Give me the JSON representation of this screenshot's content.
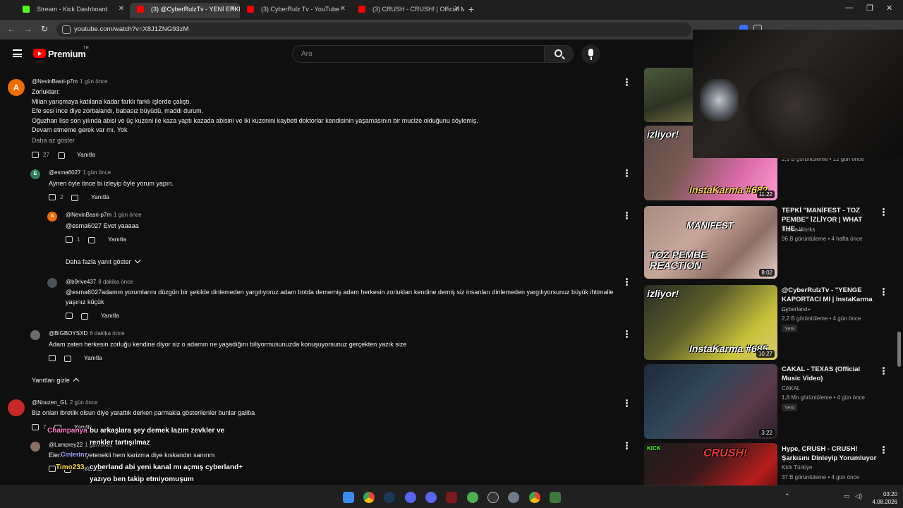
{
  "browser": {
    "tabs": [
      {
        "title": "Stream - Kick Dashboard",
        "active": false,
        "color": "#53fc18"
      },
      {
        "title": "(3) @CyberRulzTv - YENİ ERKEK",
        "active": true,
        "color": "#ff0000"
      },
      {
        "title": "(3) CyberRulz Tv - YouTube",
        "active": false,
        "color": "#ff0000"
      },
      {
        "title": "(3) CRUSH - CRUSH! | Official M",
        "active": false,
        "color": "#ff0000"
      }
    ],
    "url": "youtube.com/watch?v=X8J1ZNG93zM"
  },
  "youtube": {
    "logo_text": "Premium",
    "logo_region": "TR",
    "search_placeholder": "Ara"
  },
  "comments": [
    {
      "handle": "@NevinBasri-p7m",
      "time": "1 gün önce",
      "avatar_letter": "A",
      "avatar_color": "#ef6c00",
      "lines": [
        "Zorlukları:",
        "Milan yarışmaya katılana kadar farklı farklı işlerde çalıştı.",
        "Efe sesi ince diye zorbalandı, babasız büyüdü, maddi durum.",
        "Oğuzhan lise son yılında abisi ve üç kuzeni ile kaza yaptı kazada abisini ve iki kuzenini kaybeti doktorlar kendisinin yaşamasının bir mucize olduğunu söylemiş.",
        "Devam etmeme gerek var mı. Yok"
      ],
      "show_less": "Daha az göster",
      "likes": "27",
      "reply": "Yanıtla"
    },
    {
      "handle": "@esma6027",
      "time": "1 gün önce",
      "avatar_letter": "E",
      "avatar_color": "#2e7d57",
      "text": "Aynen öyle önce bi izleyip öyle yorum yapın.",
      "likes": "2",
      "reply": "Yanıtla"
    },
    {
      "handle": "@NevinBasri-p7m",
      "time": "1 gün önce",
      "avatar_letter": "A",
      "avatar_color": "#ef6c00",
      "text": "@esma6027 Evet yaaaaa",
      "likes": "1",
      "reply": "Yanıtla"
    },
    {
      "handle": "@b9rive437",
      "time": "8 dakika önce",
      "avatar_color": "#4a4f5a",
      "text": "@esma6027adamın yorumlarını düzgün bir şekilde dinlemeden yargılıyoruz adam botda dememiş adam herkesin zorlukları kendine demiş siz insanları dinlemeden yargılıyorsunuz büyük ihtimalle yaşınız küçük",
      "likes": "",
      "reply": "Yanıtla"
    },
    {
      "handle": "@BIGBOYSXD",
      "time": "6 dakika önce",
      "avatar_color": "#6b6b6b",
      "text": "Adam zaten herkesin zorluğu kendine diyor siz o adamın ne yaşadığını biliyormusunuzda konuşuyorsunuz gerçekten yazık size",
      "likes": "",
      "reply": "Yanıtla"
    },
    {
      "handle": "@Nouzen_GL",
      "time": "2 gün önce",
      "avatar_color": "#c62828",
      "text": "Biz onları ibretlik olsun diye yarattık derken parmakla gösterilenler bunlar galiba",
      "likes": "7",
      "reply": "Yanıtla"
    },
    {
      "handle": "@Lamprey22",
      "time": "1 gün önce",
      "avatar_color": "#8d6e63",
      "text": "Elenenler de yetenekli hem karizma diye kıskandın sanırım",
      "likes": "",
      "reply": "Yanıtla"
    }
  ],
  "thread_controls": {
    "more_replies": "Daha fazla yanıt göster",
    "hide_replies": "Yanıtları gizle"
  },
  "chat_overlay": [
    {
      "user": "Champanya",
      "user_color": "#ff7fd0",
      "msg1": "bu arkaşlara şey demek lazım zevkler ve",
      "msg2": "renkler tartışılmaz"
    },
    {
      "user": "Cinlerinz",
      "user_color": "#a7a7ff",
      "msg1": "",
      "msg2": ""
    },
    {
      "user": "Timo233",
      "user_color": "#ffd94a",
      "msg1": "cyberland abi yeni kanal mı açmış cyberland+",
      "msg2": "yazıyo ben takip etmiyomuşum"
    }
  ],
  "sidebar": [
    {
      "title": "",
      "channel": "",
      "meta": "2,9 B görüntüleme • 12 gün önce",
      "duration": "11:22",
      "caption": "InstaKarma #682",
      "header": "izliyor!"
    },
    {
      "title": "TEPKİ \"MANİFEST - TOZ PEMBE\" İZLİYOR | WHAT THE ...",
      "channel": "Hustle Works",
      "meta": "96 B görüntüleme • 4 hafta önce",
      "duration": "8:02",
      "caption": "TOZ PEMBE REACTION",
      "header": "MANIFEST"
    },
    {
      "title": "@CyberRulzTv - \"YENGE KAPORTACI MI | InstaKarma ...",
      "channel": "Cyberland+",
      "meta": "2,2 B görüntüleme • 4 gün önce",
      "duration": "10:27",
      "badge": "Yeni",
      "caption": "InstaKarma #685",
      "header": "izliyor!"
    },
    {
      "title": "CAKAL - TEXAS (Official Music Video)",
      "channel": "CAKAL",
      "meta": "1,8 Mn görüntüleme • 4 gün önce",
      "duration": "3:22",
      "badge": "Yeni",
      "caption": "",
      "header": ""
    },
    {
      "title": "Hype, CRUSH - CRUSH! Şarkısını Dinleyip Yorumluyor",
      "channel": "Kick Türkiye",
      "meta": "37 B görüntüleme • 4 gün önce",
      "duration": "",
      "caption": "CRUSH!",
      "header": "KICK"
    }
  ],
  "taskbar": {
    "time": "03:20",
    "date": "4.08.2026"
  }
}
